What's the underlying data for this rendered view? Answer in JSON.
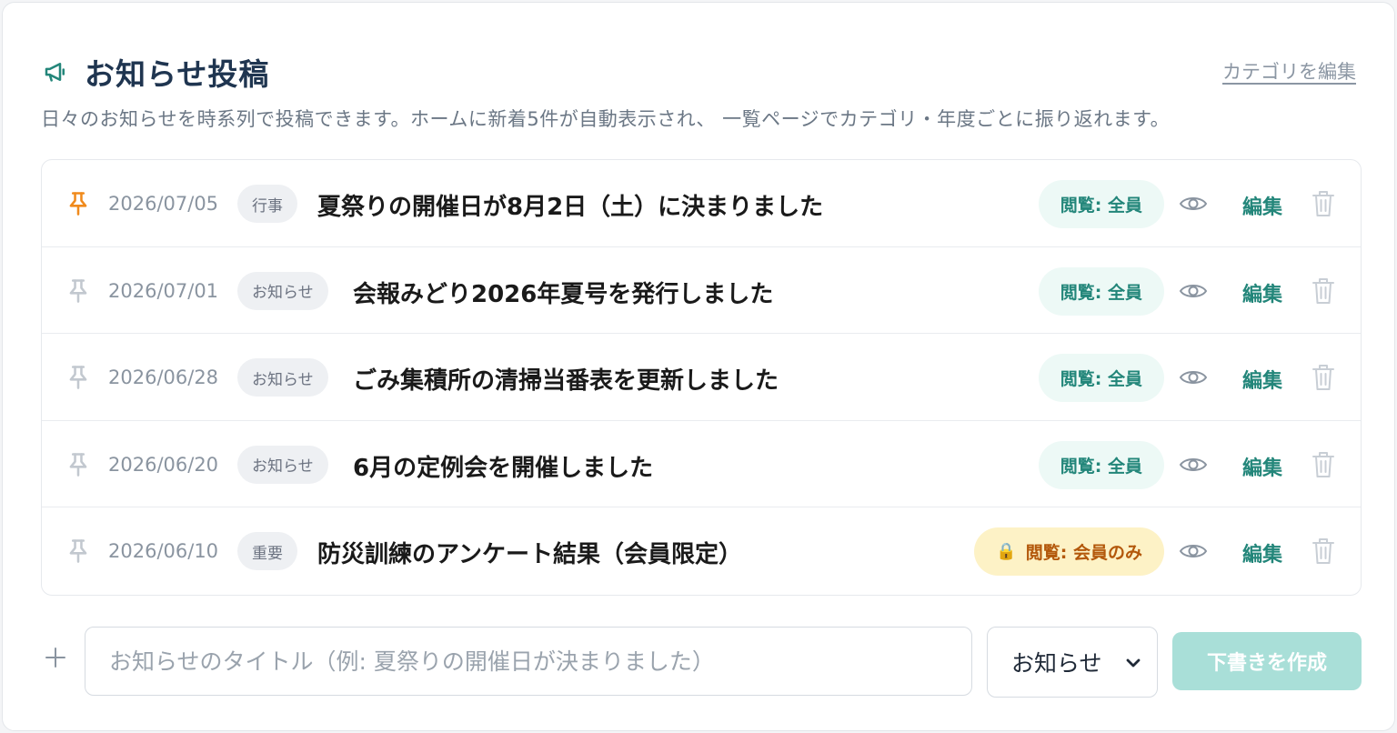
{
  "header": {
    "title": "お知らせ投稿",
    "edit_categories_link": "カテゴリを編集",
    "description": "日々のお知らせを時系列で投稿できます。ホームに新着5件が自動表示され、 一覧ページでカテゴリ・年度ごとに振り返れます。"
  },
  "posts": [
    {
      "date": "2026/07/05",
      "category": "行事",
      "title": "夏祭りの開催日が8月2日（土）に決まりました",
      "visibility": "閲覧: 全員",
      "pinned": true,
      "edit": "編集"
    },
    {
      "date": "2026/07/01",
      "category": "お知らせ",
      "title": "会報みどり2026年夏号を発行しました",
      "visibility": "閲覧: 全員",
      "pinned": false,
      "edit": "編集"
    },
    {
      "date": "2026/06/28",
      "category": "お知らせ",
      "title": "ごみ集積所の清掃当番表を更新しました",
      "visibility": "閲覧: 全員",
      "pinned": false,
      "edit": "編集"
    },
    {
      "date": "2026/06/20",
      "category": "お知らせ",
      "title": "6月の定例会を開催しました",
      "visibility": "閲覧: 全員",
      "pinned": false,
      "edit": "編集"
    },
    {
      "date": "2026/06/10",
      "category": "重要",
      "title": "防災訓練のアンケート結果（会員限定）",
      "visibility": "閲覧: 会員のみ",
      "pinned": false,
      "edit": "編集",
      "lock_icon": "🔒"
    }
  ],
  "composer": {
    "title_placeholder": "お知らせのタイトル（例: 夏祭りの開催日が決まりました）",
    "title_value": "",
    "category_selected": "お知らせ",
    "create_button": "下書きを作成"
  },
  "colors": {
    "accent": "#23867a",
    "title": "#1f3550",
    "pin_active": "#f08a1c",
    "pin_inactive": "#c2c8cf",
    "members_badge_bg": "#fdf2c6",
    "members_badge_text": "#b3580b",
    "create_button_bg": "#a9dfd8"
  },
  "icons": {
    "header": "megaphone-icon",
    "pin": "pin-icon",
    "view": "eye-icon",
    "delete": "trash-icon",
    "add": "plus-icon",
    "select": "chevron-down-icon",
    "locked": "lock-icon"
  }
}
